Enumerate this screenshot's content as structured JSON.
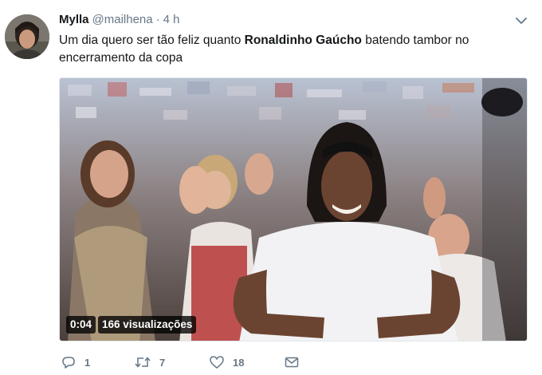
{
  "author": {
    "name": "Mylla",
    "handle": "@mailhena",
    "separator": "·",
    "time": "4 h"
  },
  "tweet_text": {
    "part1": "Um dia quero ser tão feliz quanto ",
    "bold": "Ronaldinho Gaúcho",
    "part2": " batendo tambor no encerramento da copa"
  },
  "video": {
    "duration": "0:04",
    "views": "166 visualizações"
  },
  "actions": {
    "reply_count": "1",
    "retweet_count": "7",
    "like_count": "18"
  },
  "icons": {
    "caret": "chevron-down-icon",
    "reply": "reply-icon",
    "retweet": "retweet-icon",
    "like": "heart-icon",
    "dm": "envelope-icon"
  },
  "colors": {
    "text": "#14171a",
    "secondary": "#657786",
    "accent": "#1da1f2"
  }
}
